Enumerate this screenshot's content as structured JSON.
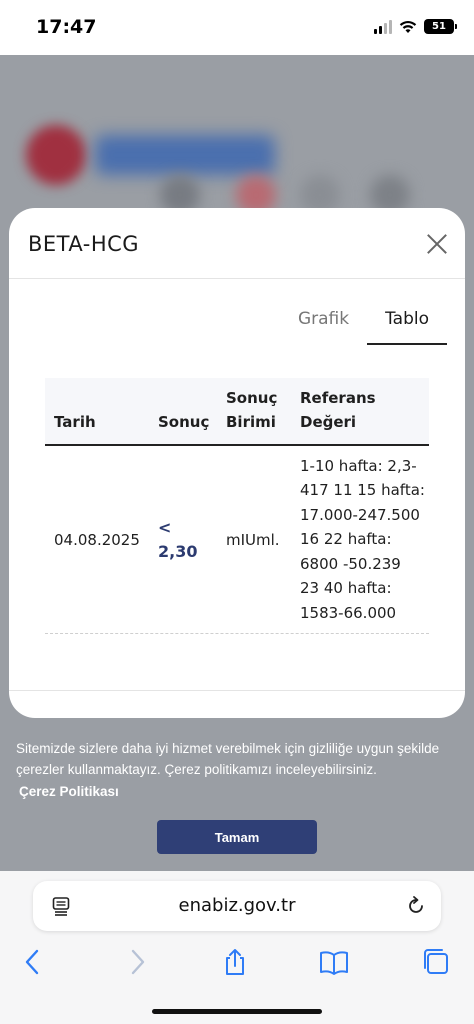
{
  "status_bar": {
    "time": "17:47",
    "battery": "51"
  },
  "modal": {
    "title": "BETA-HCG",
    "tabs": [
      {
        "label": "Grafik",
        "active": false
      },
      {
        "label": "Tablo",
        "active": true
      }
    ],
    "table": {
      "headers": [
        "Tarih",
        "Sonuç",
        "Sonuç Birimi",
        "Referans Değeri"
      ],
      "rows": [
        {
          "date": "04.08.2025",
          "result_prefix": "<",
          "result_value": "2,30",
          "unit": "mIUml.",
          "reference": "1-10 hafta: 2,3-\n417 11 15 hafta:\n17.000-247.500\n16 22 hafta:\n6800 -50.239\n23 40 hafta:\n1583-66.000"
        }
      ]
    }
  },
  "cookie_banner": {
    "text": "Sitemizde sizlere daha iyi hizmet verebilmek için gizliliğe uygun şekilde çerezler kullanmaktayız. Çerez politikamızı inceleyebilirsiniz.",
    "link_label": "Çerez Politikası",
    "button_label": "Tamam"
  },
  "browser": {
    "url": "enabiz.gov.tr",
    "icons": [
      "reader-mode-icon",
      "reload-icon",
      "back-icon",
      "forward-icon",
      "share-icon",
      "bookmarks-icon",
      "tabs-icon"
    ]
  },
  "colors": {
    "accent": "#2f3f76",
    "result_text": "#2c3b70",
    "ios_blue": "#2f7cf6"
  }
}
